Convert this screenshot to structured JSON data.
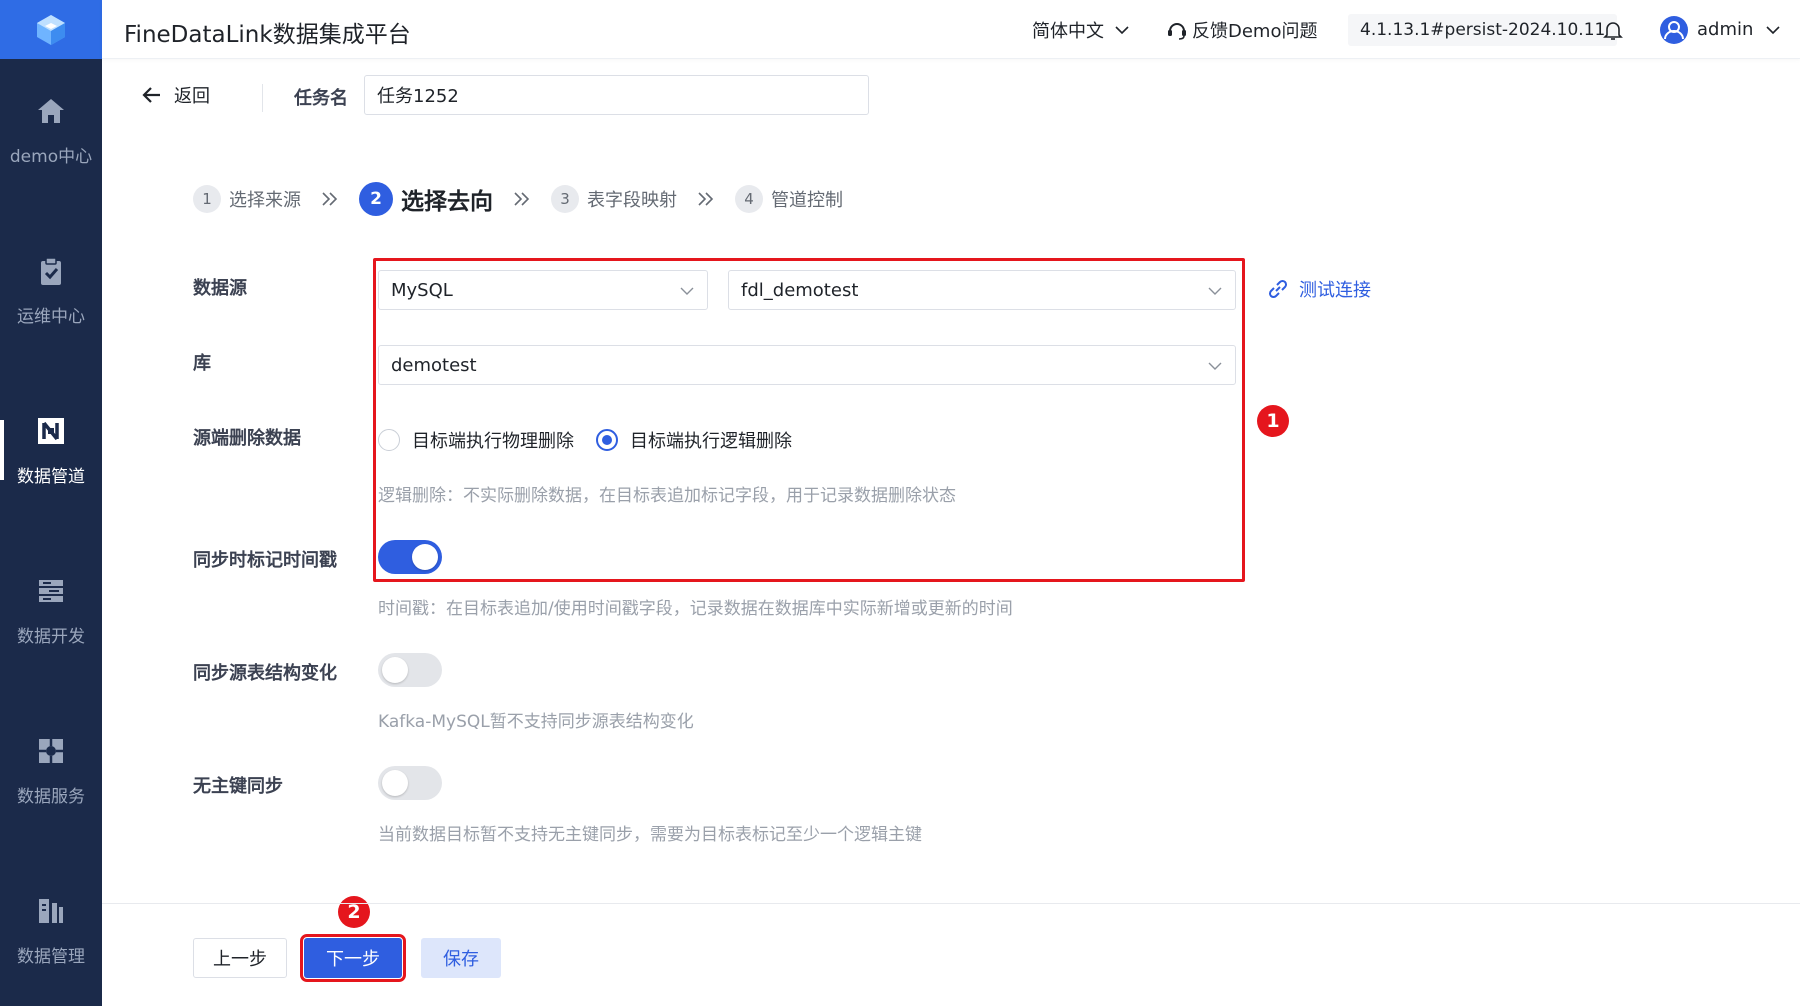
{
  "app": {
    "title": "FineDataLink数据集成平台"
  },
  "topbar": {
    "language": "简体中文",
    "feedback": "反馈Demo问题",
    "version": "4.1.13.1#persist-2024.10.11",
    "user": "admin"
  },
  "sidebar": {
    "items": [
      {
        "label": "demo中心",
        "icon": "home-icon"
      },
      {
        "label": "运维中心",
        "icon": "clipboard-check-icon"
      },
      {
        "label": "数据管道",
        "icon": "pipeline-icon",
        "active": true
      },
      {
        "label": "数据开发",
        "icon": "dev-icon"
      },
      {
        "label": "数据服务",
        "icon": "service-icon"
      },
      {
        "label": "数据管理",
        "icon": "manage-icon"
      }
    ]
  },
  "header": {
    "back_label": "返回",
    "task_name_label": "任务名",
    "task_name_value": "任务1252"
  },
  "steps": [
    {
      "num": "1",
      "label": "选择来源"
    },
    {
      "num": "2",
      "label": "选择去向",
      "active": true
    },
    {
      "num": "3",
      "label": "表字段映射"
    },
    {
      "num": "4",
      "label": "管道控制"
    }
  ],
  "form": {
    "datasource_label": "数据源",
    "datasource_type": "MySQL",
    "datasource_conn": "fdl_demotest",
    "test_connection": "测试连接",
    "database_label": "库",
    "database_value": "demotest",
    "delete_label": "源端删除数据",
    "delete_option_physical": "目标端执行物理删除",
    "delete_option_logical": "目标端执行逻辑删除",
    "delete_selected": "logical",
    "delete_hint": "逻辑删除：不实际删除数据，在目标表追加标记字段，用于记录数据删除状态",
    "timestamp_label": "同步时标记时间戳",
    "timestamp_on": true,
    "timestamp_hint": "时间戳：在目标表追加/使用时间戳字段，记录数据在数据库中实际新增或更新的时间",
    "schema_change_label": "同步源表结构变化",
    "schema_change_on": false,
    "schema_change_hint": "Kafka-MySQL暂不支持同步源表结构变化",
    "no_pk_label": "无主键同步",
    "no_pk_on": false,
    "no_pk_hint": "当前数据目标暂不支持无主键同步，需要为目标表标记至少一个逻辑主键"
  },
  "annotations": {
    "badge1": "1",
    "badge2": "2"
  },
  "footer": {
    "prev": "上一步",
    "next": "下一步",
    "save": "保存"
  },
  "colors": {
    "accent": "#2f5ee0",
    "sidebar": "#1b2a4a",
    "highlight": "#e5161d"
  }
}
